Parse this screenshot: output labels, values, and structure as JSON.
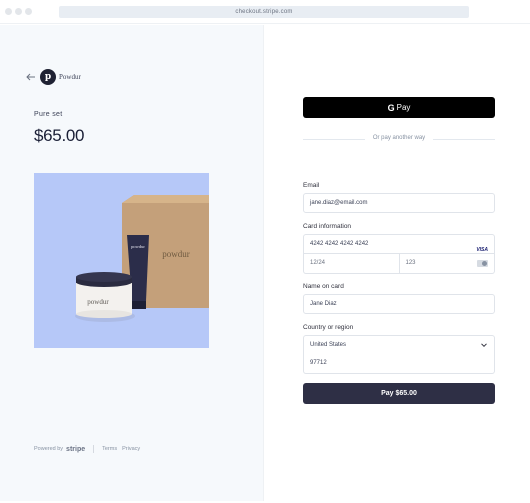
{
  "browser": {
    "url": "checkout.stripe.com"
  },
  "merchant": {
    "logo_letter": "p",
    "name": "Powdur"
  },
  "product": {
    "name": "Pure set",
    "price": "$65.00",
    "box_text": "powdur",
    "tube_text": "powdur",
    "jar_text": "powdur"
  },
  "footer": {
    "powered_by": "Powered by",
    "stripe": "stripe",
    "terms": "Terms",
    "privacy": "Privacy"
  },
  "payment": {
    "gpay_g": "G",
    "gpay_label": "Pay",
    "divider_text": "Or pay another way",
    "email_label": "Email",
    "email_value": "jane.diaz@email.com",
    "card_label": "Card information",
    "card_number": "4242 4242 4242 4242",
    "card_brand": "VISA",
    "expiry": "12/24",
    "cvc": "123",
    "name_label": "Name on card",
    "name_value": "Jane Diaz",
    "country_label": "Country or region",
    "country_value": "United States",
    "zip_value": "97712",
    "pay_button": "Pay $65.00"
  },
  "colors": {
    "left_bg": "#f6f9fc",
    "product_bg": "#b6c8f8",
    "pay_button": "#2e2f45",
    "gpay_button": "#000000"
  }
}
